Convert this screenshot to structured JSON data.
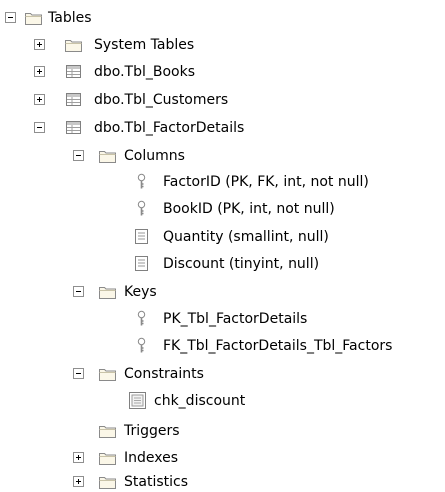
{
  "tree": {
    "tables": "Tables",
    "system_tables": "System Tables",
    "tbl_books": "dbo.Tbl_Books",
    "tbl_customers": "dbo.Tbl_Customers",
    "tbl_factordetails": "dbo.Tbl_FactorDetails",
    "columns": "Columns",
    "col_factorid": "FactorID (PK, FK, int, not null)",
    "col_bookid": "BookID (PK, int, not null)",
    "col_quantity": "Quantity (smallint, null)",
    "col_discount": "Discount (tinyint, null)",
    "keys": "Keys",
    "key_pk": "PK_Tbl_FactorDetails",
    "key_fk": "FK_Tbl_FactorDetails_Tbl_Factors",
    "constraints": "Constraints",
    "chk_discount": "chk_discount",
    "triggers": "Triggers",
    "indexes": "Indexes",
    "statistics": "Statistics"
  },
  "icons": {
    "folder": "folder-icon",
    "table": "table-icon",
    "column": "column-icon",
    "key": "key-icon",
    "constraint": "constraint-icon"
  }
}
